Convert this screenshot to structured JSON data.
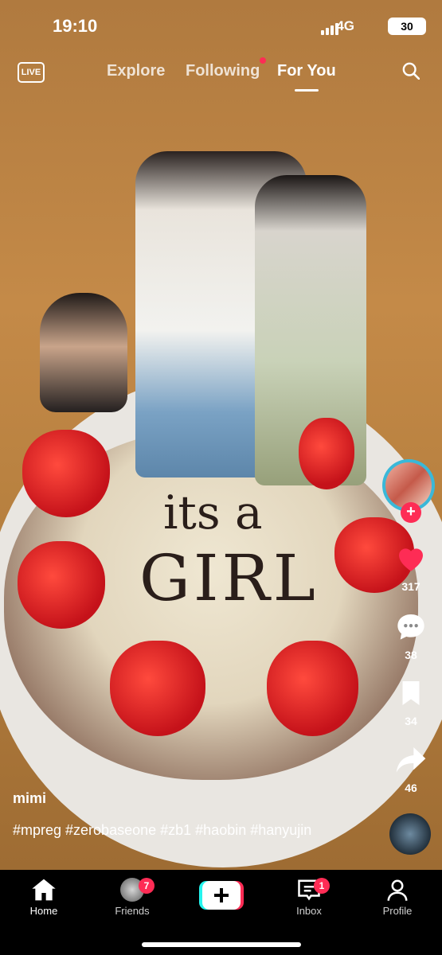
{
  "status_bar": {
    "time": "19:10",
    "network": "4G",
    "battery": "30"
  },
  "top_nav": {
    "live_label": "LIVE",
    "tabs": [
      {
        "label": "Explore",
        "active": false
      },
      {
        "label": "Following",
        "active": false,
        "has_notification_dot": true
      },
      {
        "label": "For You",
        "active": true
      }
    ]
  },
  "video": {
    "cake_text_line1": "its a",
    "cake_text_line2": "GIRL"
  },
  "actions": {
    "likes": "317",
    "comments": "38",
    "saves": "34",
    "shares": "46"
  },
  "caption": {
    "username": "mimi",
    "hashtags": "#mpreg #zerobaseone #zb1 #haobin #hanyujin"
  },
  "bottom_nav": {
    "items": [
      {
        "label": "Home",
        "active": true,
        "icon": "home-icon"
      },
      {
        "label": "Friends",
        "badge": "7",
        "icon": "friends-avatar"
      },
      {
        "label": "",
        "icon": "create-plus-icon"
      },
      {
        "label": "Inbox",
        "badge": "1",
        "icon": "inbox-icon"
      },
      {
        "label": "Profile",
        "icon": "profile-icon"
      }
    ]
  },
  "colors": {
    "accent": "#fe2c55",
    "ring": "#3ab8d8"
  }
}
